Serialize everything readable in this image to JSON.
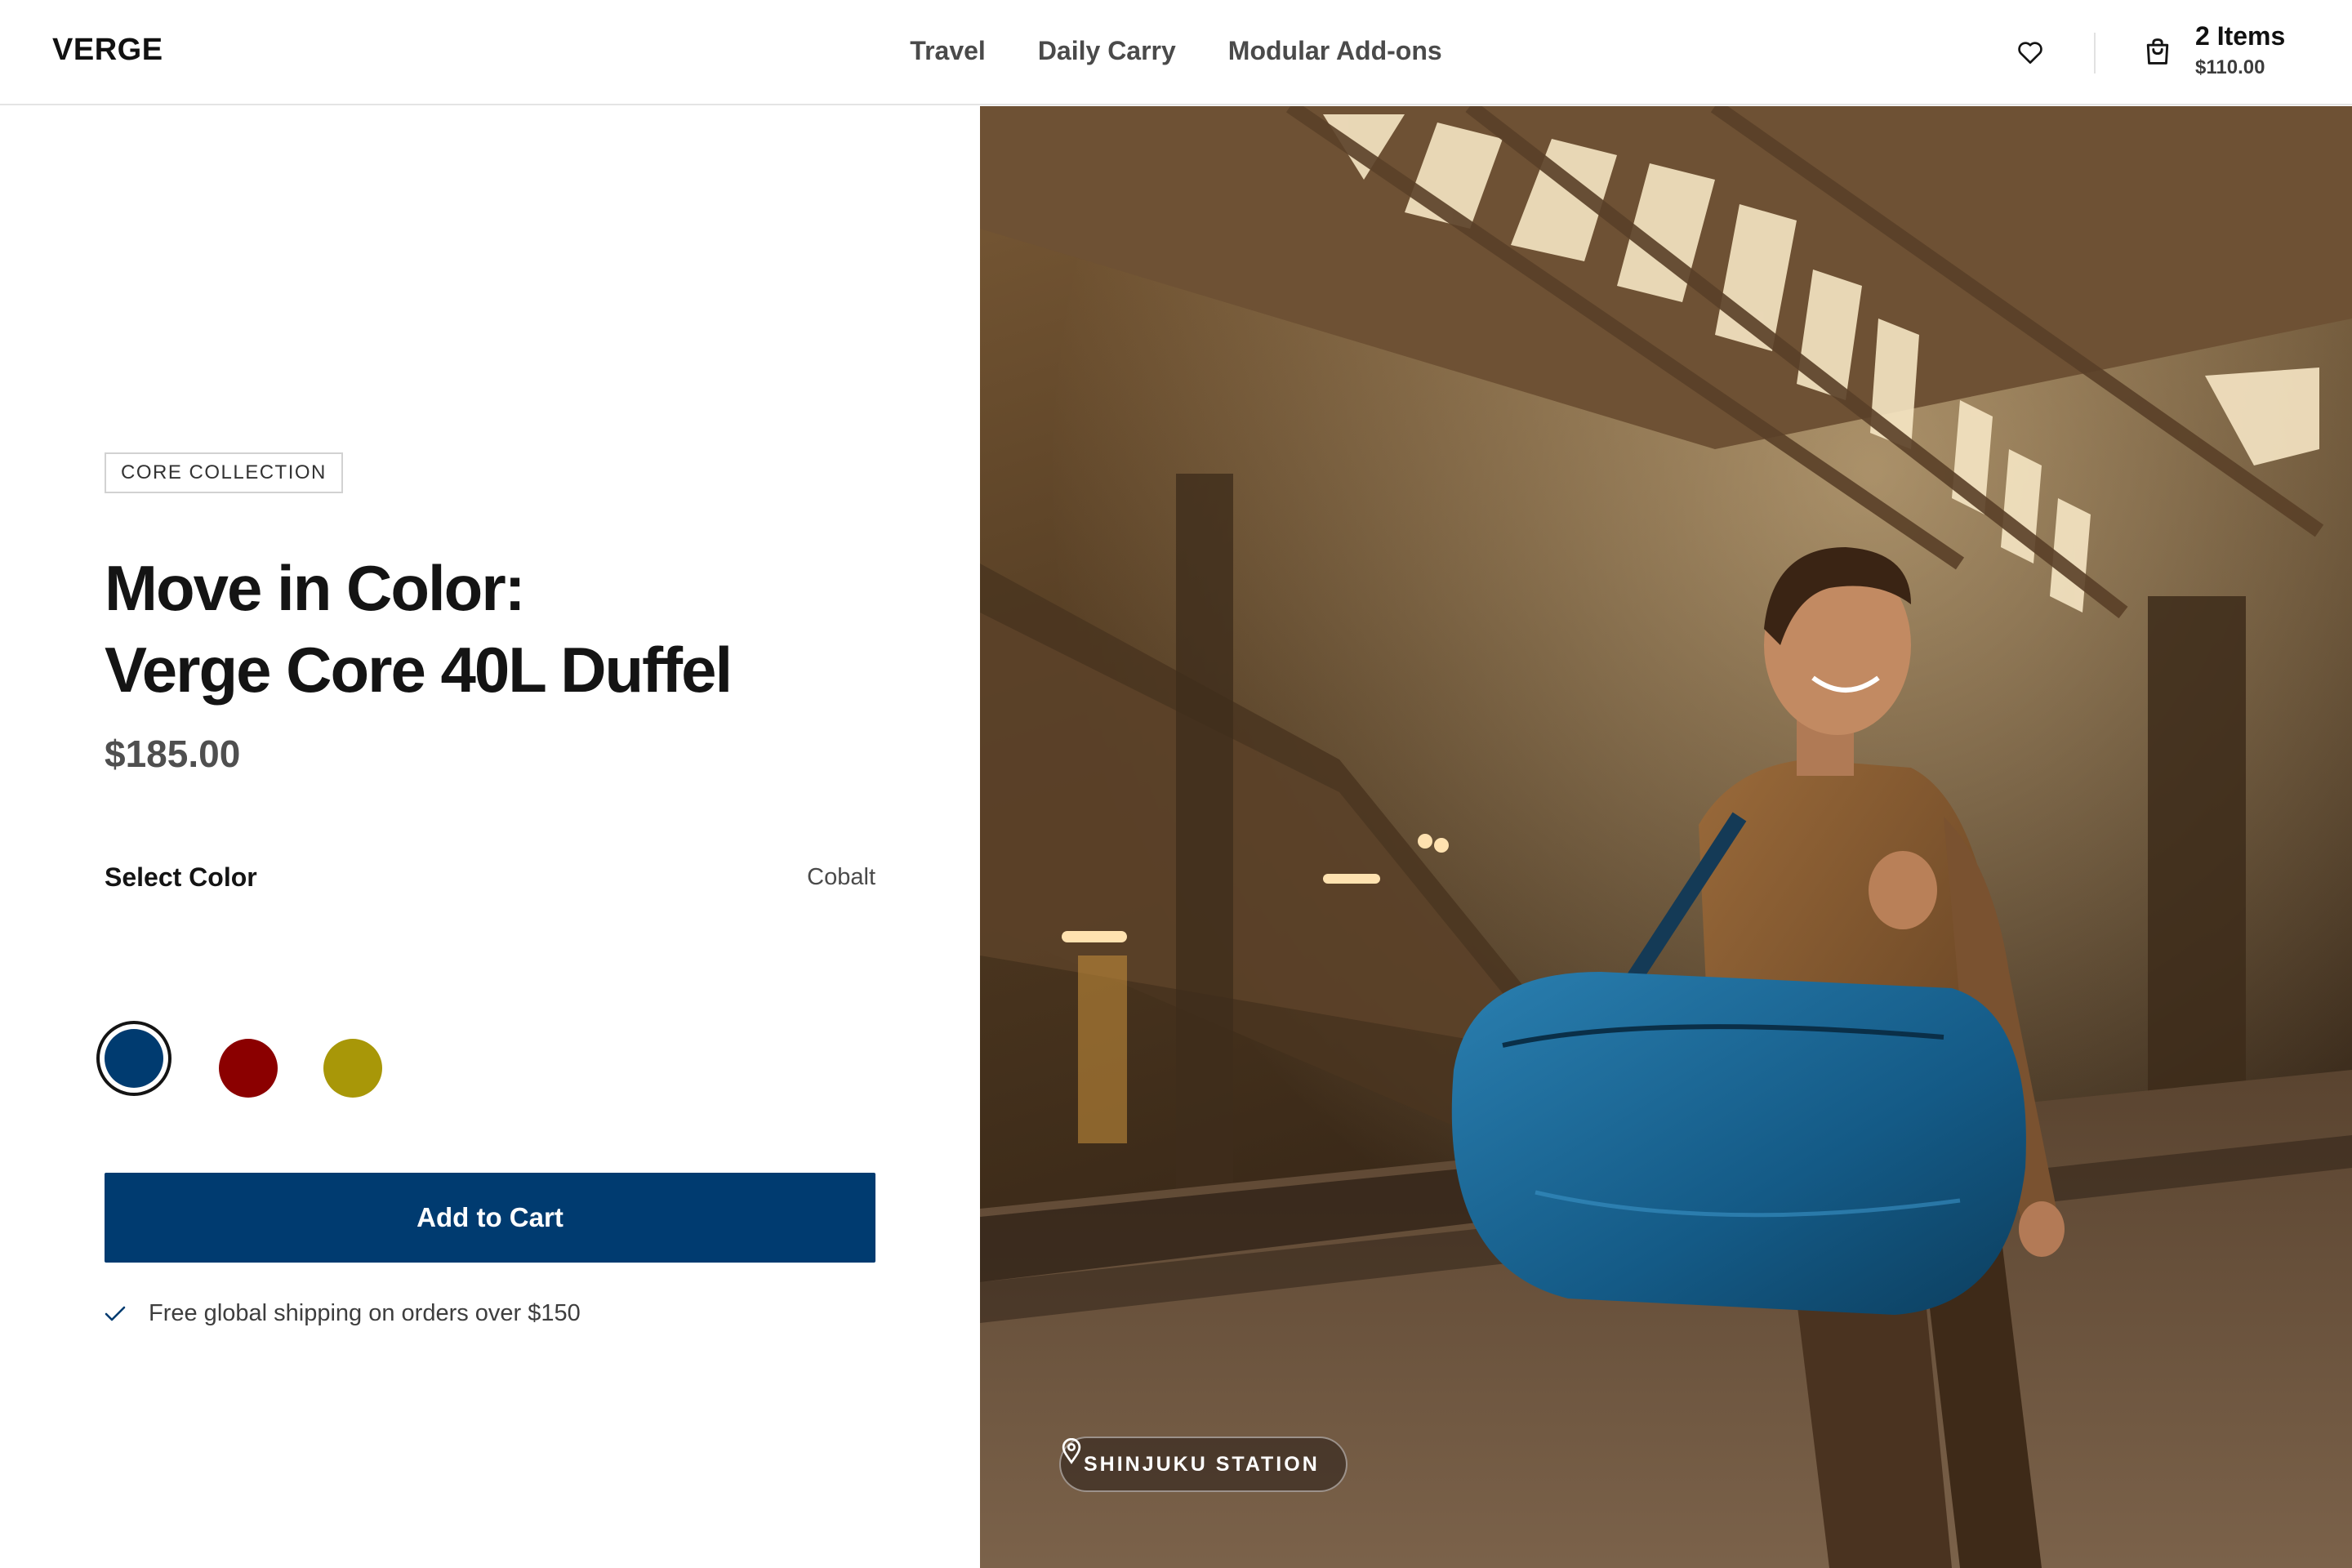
{
  "brand": {
    "logo": "VERGE"
  },
  "nav": {
    "items": [
      "Travel",
      "Daily Carry",
      "Modular Add-ons"
    ]
  },
  "header": {
    "wishlist_icon": "heart-icon",
    "cart": {
      "icon": "shopping-bag-icon",
      "count_label": "2 Items",
      "total": "$110.00"
    }
  },
  "product": {
    "tag": "CORE COLLECTION",
    "title_line1": "Move in Color:",
    "title_line2": "Verge Core 40L Duffel",
    "price": "$185.00",
    "color_label": "Select Color",
    "selected_color": "Cobalt",
    "swatches": [
      {
        "color": "#003b70",
        "selected": true
      },
      {
        "color": "#8b0000",
        "selected": false
      },
      {
        "color": "#a89708",
        "selected": false
      }
    ],
    "add_to_cart": "Add to Cart",
    "shipping_note": "Free global shipping on orders over $150",
    "shipping_icon": "checkmark-icon"
  },
  "hero": {
    "location_icon": "map-pin-icon",
    "location": "SHINJUKU STATION"
  },
  "colors": {
    "accent": "#003b70",
    "text": "#141414",
    "muted": "#4a4a4a",
    "border": "#e4e4e4"
  }
}
